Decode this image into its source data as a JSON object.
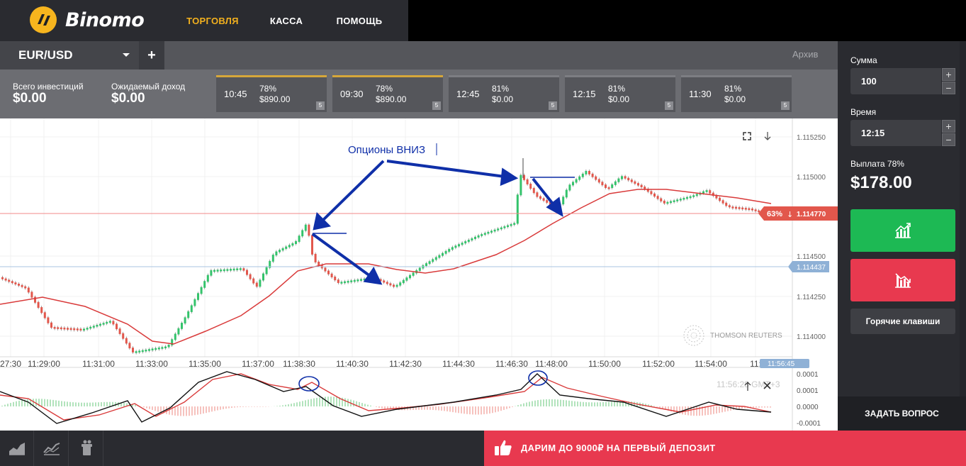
{
  "brand": {
    "name": "Binomo",
    "logo_color": "#f7b51e"
  },
  "nav": [
    {
      "label": "ТОРГОВЛЯ",
      "active": true
    },
    {
      "label": "КАССА",
      "active": false
    },
    {
      "label": "ПОМОЩЬ",
      "active": false
    }
  ],
  "asset": {
    "label": "EUR/USD",
    "add_label": "+",
    "archive_label": "Архив"
  },
  "summary": {
    "invest_label": "Всего инвестиций",
    "invest_value": "$0.00",
    "income_label": "Ожидаемый доход",
    "income_value": "$0.00"
  },
  "deals": [
    {
      "time": "10:45",
      "pct": "78%",
      "amount": "$890.00",
      "badge": "5"
    },
    {
      "time": "09:30",
      "pct": "78%",
      "amount": "$890.00",
      "badge": "5"
    },
    {
      "time": "12:45",
      "pct": "81%",
      "amount": "$0.00",
      "badge": "5"
    },
    {
      "time": "12:15",
      "pct": "81%",
      "amount": "$0.00",
      "badge": "5"
    },
    {
      "time": "11:30",
      "pct": "81%",
      "amount": "$0.00",
      "badge": "5"
    }
  ],
  "chart": {
    "annotation": "Опционы ВНИЗ",
    "price_ticks": [
      "1.115250",
      "1.115000",
      "1.114500",
      "1.114250",
      "1.114000"
    ],
    "time_ticks": [
      "27:30",
      "11:29:00",
      "11:31:00",
      "11:33:00",
      "11:35:00",
      "11:37:00",
      "11:38:30",
      "11:40:30",
      "11:42:30",
      "11:44:30",
      "11:46:30",
      "11:48:00",
      "11:50:00",
      "11:52:00",
      "11:54:00",
      "11:"
    ],
    "current_price": "1.114770",
    "current_pct": "63%",
    "level_price": "1.114437",
    "current_time": "11:56:45",
    "watermark": "THOMSON REUTERS",
    "osc_ticks": [
      "0.0001",
      "0.0001",
      "0.0000",
      "-0.0001"
    ],
    "osc_time": "11:56:28 GMT+3",
    "colors": {
      "up": "#34c36b",
      "down": "#e2574c",
      "ma": "#d93a3a",
      "annotation": "#0f2fa8"
    }
  },
  "order": {
    "amount_label": "Сумма",
    "amount_value": "100",
    "time_label": "Время",
    "time_value": "12:15",
    "payout_label": "Выплата 78%",
    "payout_value": "$178.00",
    "hotkeys_label": "Горячие клавиши",
    "ask_label": "ЗАДАТЬ ВОПРОС",
    "up_color": "#1db954",
    "down_color": "#e8394f"
  },
  "promo": {
    "label": "ДАРИМ ДО 9000₽ НА ПЕРВЫЙ ДЕПОЗИТ"
  },
  "tools": [
    {
      "icon": "area-chart-icon"
    },
    {
      "icon": "line-chart-icon"
    },
    {
      "icon": "indicator-tools-icon"
    }
  ]
}
